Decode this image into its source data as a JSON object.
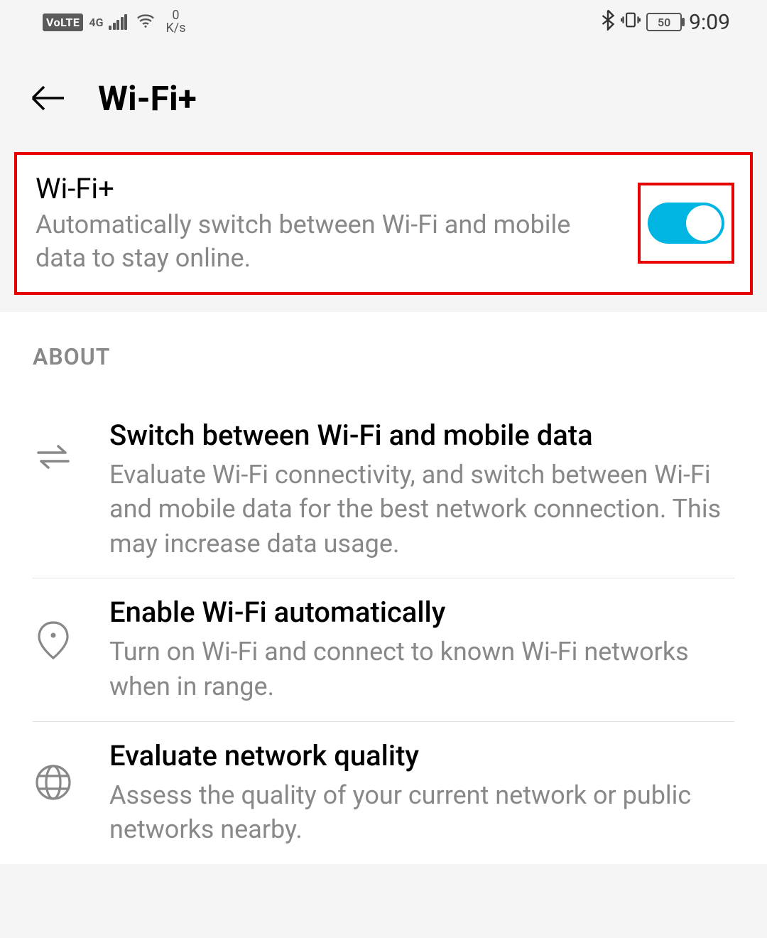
{
  "status": {
    "volte": "VoLTE",
    "network_gen": "4G",
    "speed_value": "0",
    "speed_unit": "K/s",
    "battery": "50",
    "clock": "9:09"
  },
  "header": {
    "title": "Wi-Fi+"
  },
  "toggle": {
    "title": "Wi-Fi+",
    "description": "Automatically switch between Wi-Fi and mobile data to stay online.",
    "enabled": true
  },
  "about": {
    "section_label": "ABOUT",
    "items": [
      {
        "icon": "swap",
        "title": "Switch between Wi-Fi and mobile data",
        "description": "Evaluate Wi-Fi connectivity, and switch between Wi-Fi and mobile data for the best network connection. This may increase data usage."
      },
      {
        "icon": "location",
        "title": "Enable Wi-Fi automatically",
        "description": "Turn on Wi-Fi and connect to known Wi-Fi networks when in range."
      },
      {
        "icon": "globe",
        "title": "Evaluate network quality",
        "description": "Assess the quality of your current network or public networks nearby."
      }
    ]
  }
}
